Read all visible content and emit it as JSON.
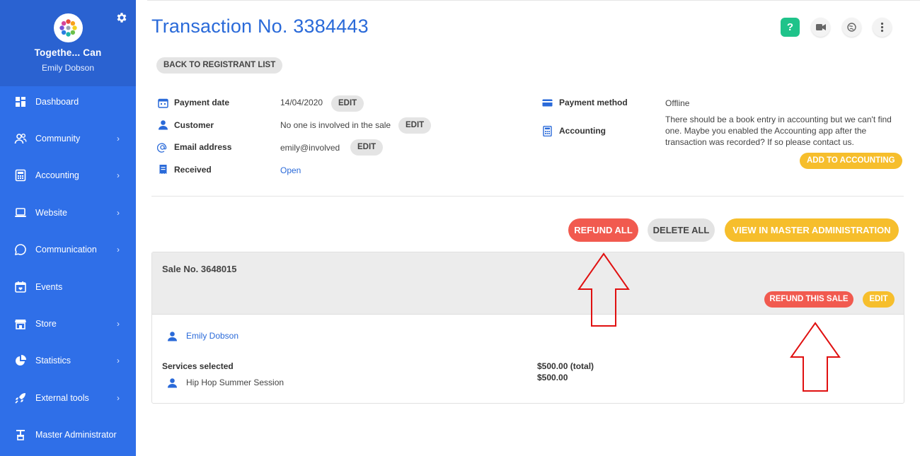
{
  "sidebar": {
    "org_name": "Togethe... Can",
    "user_name": "Emily Dobson",
    "items": [
      {
        "label": "Dashboard",
        "icon": "dashboard-icon",
        "chevron": false
      },
      {
        "label": "Community",
        "icon": "community-icon",
        "chevron": true
      },
      {
        "label": "Accounting",
        "icon": "calculator-icon",
        "chevron": true
      },
      {
        "label": "Website",
        "icon": "laptop-icon",
        "chevron": true
      },
      {
        "label": "Communication",
        "icon": "chat-icon",
        "chevron": true
      },
      {
        "label": "Events",
        "icon": "calendar-icon",
        "chevron": false
      },
      {
        "label": "Store",
        "icon": "store-icon",
        "chevron": true
      },
      {
        "label": "Statistics",
        "icon": "pie-chart-icon",
        "chevron": true
      },
      {
        "label": "External tools",
        "icon": "rocket-icon",
        "chevron": true
      },
      {
        "label": "Master Administrator",
        "icon": "admin-icon",
        "chevron": false
      }
    ],
    "chevron_glyph": "›"
  },
  "header": {
    "title": "Transaction No. 3384443",
    "help_label": "?"
  },
  "back_button": "BACK TO REGISTRANT LIST",
  "details": {
    "payment_date": {
      "label": "Payment date",
      "value": "14/04/2020",
      "edit": "EDIT"
    },
    "customer": {
      "label": "Customer",
      "value": "No one is involved in the sale",
      "edit": "EDIT"
    },
    "email": {
      "label": "Email address",
      "value": "emily@involved",
      "edit": "EDIT"
    },
    "received": {
      "label": "Received",
      "value": "Open"
    },
    "payment_method": {
      "label": "Payment method",
      "value": "Offline"
    },
    "accounting": {
      "label": "Accounting",
      "line1": "There should be a book entry in accounting but we can't find",
      "line2": "one. Maybe you enabled the Accounting app after the",
      "line3": "transaction was recorded? If so please contact us.",
      "button": "ADD TO ACCOUNTING"
    }
  },
  "actions": {
    "refund_all": "REFUND ALL",
    "delete_all": "DELETE ALL",
    "view_master": "VIEW IN MASTER ADMINISTRATION"
  },
  "sale": {
    "title": "Sale No. 3648015",
    "refund_button": "REFUND THIS SALE",
    "edit_button": "EDIT",
    "person": "Emily Dobson",
    "services_label": "Services selected",
    "service_name": "Hip Hop Summer Session",
    "total": "$500.00 (total)",
    "amount": "$500.00"
  },
  "colors": {
    "sidebar": "#2f6fe8",
    "accent_blue": "#2a6ad9",
    "red": "#f15a4f",
    "yellow": "#f6be2c",
    "arrow_red": "#e01010"
  }
}
